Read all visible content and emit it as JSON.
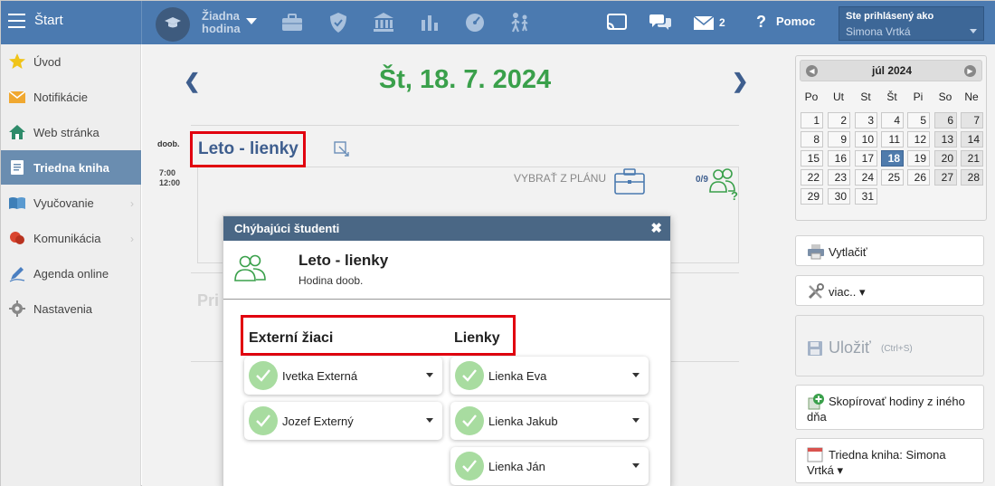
{
  "topbar": {
    "menu_label": "Štart",
    "no_hour_line1": "Žiadna",
    "no_hour_line2": "hodina",
    "messages_count": "2",
    "help_label": "Pomoc",
    "user_line1": "Ste prihlásený ako",
    "user_name": "Simona Vrtká"
  },
  "sidebar": {
    "items": [
      {
        "label": "Úvod",
        "icon": "star-icon"
      },
      {
        "label": "Notifikácie",
        "icon": "envelope-icon"
      },
      {
        "label": "Web stránka",
        "icon": "home-icon"
      },
      {
        "label": "Triedna kniha",
        "icon": "book-icon",
        "active": true
      },
      {
        "label": "Vyučovanie",
        "icon": "open-book-icon"
      },
      {
        "label": "Komunikácia",
        "icon": "chat-icon"
      },
      {
        "label": "Agenda online",
        "icon": "pen-icon"
      },
      {
        "label": "Nastavenia",
        "icon": "gear-icon"
      }
    ]
  },
  "day": {
    "date_title": "Št, 18. 7. 2024",
    "lesson_type": "doob.",
    "time_start": "7:00",
    "time_end": "12:00",
    "lesson_title": "Leto - lienky",
    "from_plan": "VYBRAŤ Z PLÁNU",
    "attendance": "0/9",
    "faded_text": "Pri"
  },
  "modal": {
    "title": "Chýbajúci študenti",
    "close": "✖",
    "lesson_name": "Leto - lienky",
    "lesson_sub": "Hodina doob.",
    "col_external": "Externí žiaci",
    "col_lienky": "Lienky",
    "external_students": [
      "Ivetka Externá",
      "Jozef Externý"
    ],
    "lienky_students": [
      "Lienka Eva",
      "Lienka Jakub",
      "Lienka Ján"
    ]
  },
  "calendar": {
    "month": "júl 2024",
    "weekdays": [
      "Po",
      "Ut",
      "St",
      "Št",
      "Pi",
      "So",
      "Ne"
    ],
    "weeks": [
      [
        "1",
        "2",
        "3",
        "4",
        "5",
        "6",
        "7"
      ],
      [
        "8",
        "9",
        "10",
        "11",
        "12",
        "13",
        "14"
      ],
      [
        "15",
        "16",
        "17",
        "18",
        "19",
        "20",
        "21"
      ],
      [
        "22",
        "23",
        "24",
        "25",
        "26",
        "27",
        "28"
      ],
      [
        "29",
        "30",
        "31",
        "",
        "",
        "",
        ""
      ]
    ],
    "today": "18"
  },
  "actions": {
    "print": "Vytlačiť",
    "more": "viac.. ▾",
    "save": "Uložiť",
    "save_hint": "(Ctrl+S)",
    "copy_line1": "Skopírovať hodiny z iného",
    "copy_line2": "dňa",
    "book_line1": "Triedna kniha: Simona",
    "book_line2": "Vrtká ▾"
  },
  "colors": {
    "topbar": "#4b7ab0",
    "accent_green": "#3aa04b",
    "highlight_red": "#e1000f",
    "title_blue": "#3e5e8e"
  }
}
